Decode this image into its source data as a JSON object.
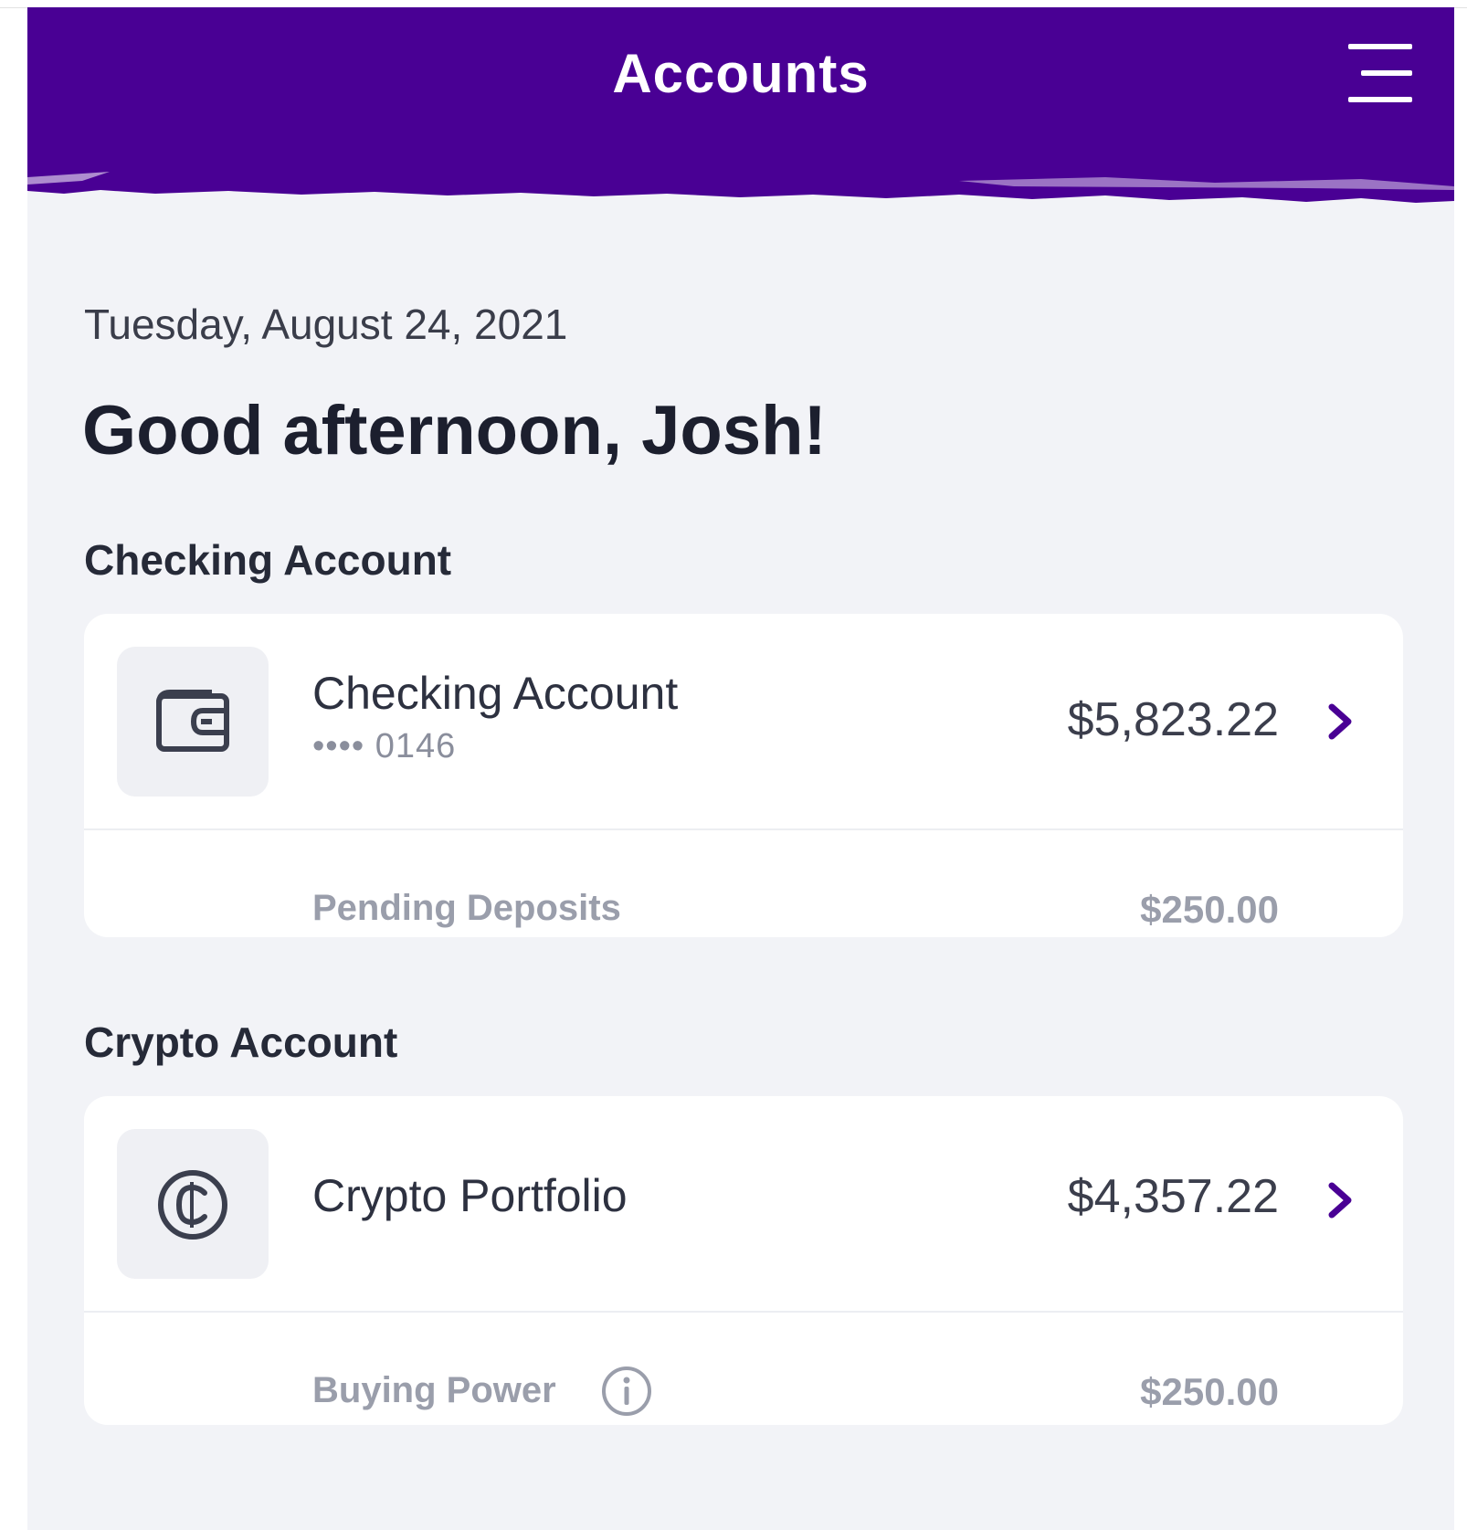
{
  "header": {
    "title": "Accounts",
    "menu_icon": "hamburger-menu-icon",
    "color": "#490094"
  },
  "greeting": {
    "date": "Tuesday, August 24, 2021",
    "message": "Good afternoon, Josh!"
  },
  "checking": {
    "section_title": "Checking Account",
    "icon": "wallet-icon",
    "account_name": "Checking Account",
    "account_mask": "•••• 0146",
    "balance": "$5,823.22",
    "sub_label": "Pending Deposits",
    "sub_value": "$250.00"
  },
  "crypto": {
    "section_title": "Crypto Account",
    "icon": "crypto-coin-icon",
    "account_name": "Crypto Portfolio",
    "balance": "$4,357.22",
    "sub_label": "Buying Power",
    "sub_icon": "info-icon",
    "sub_value": "$250.00"
  },
  "colors": {
    "accent": "#490094",
    "background": "#f2f3f7",
    "card": "#ffffff"
  }
}
